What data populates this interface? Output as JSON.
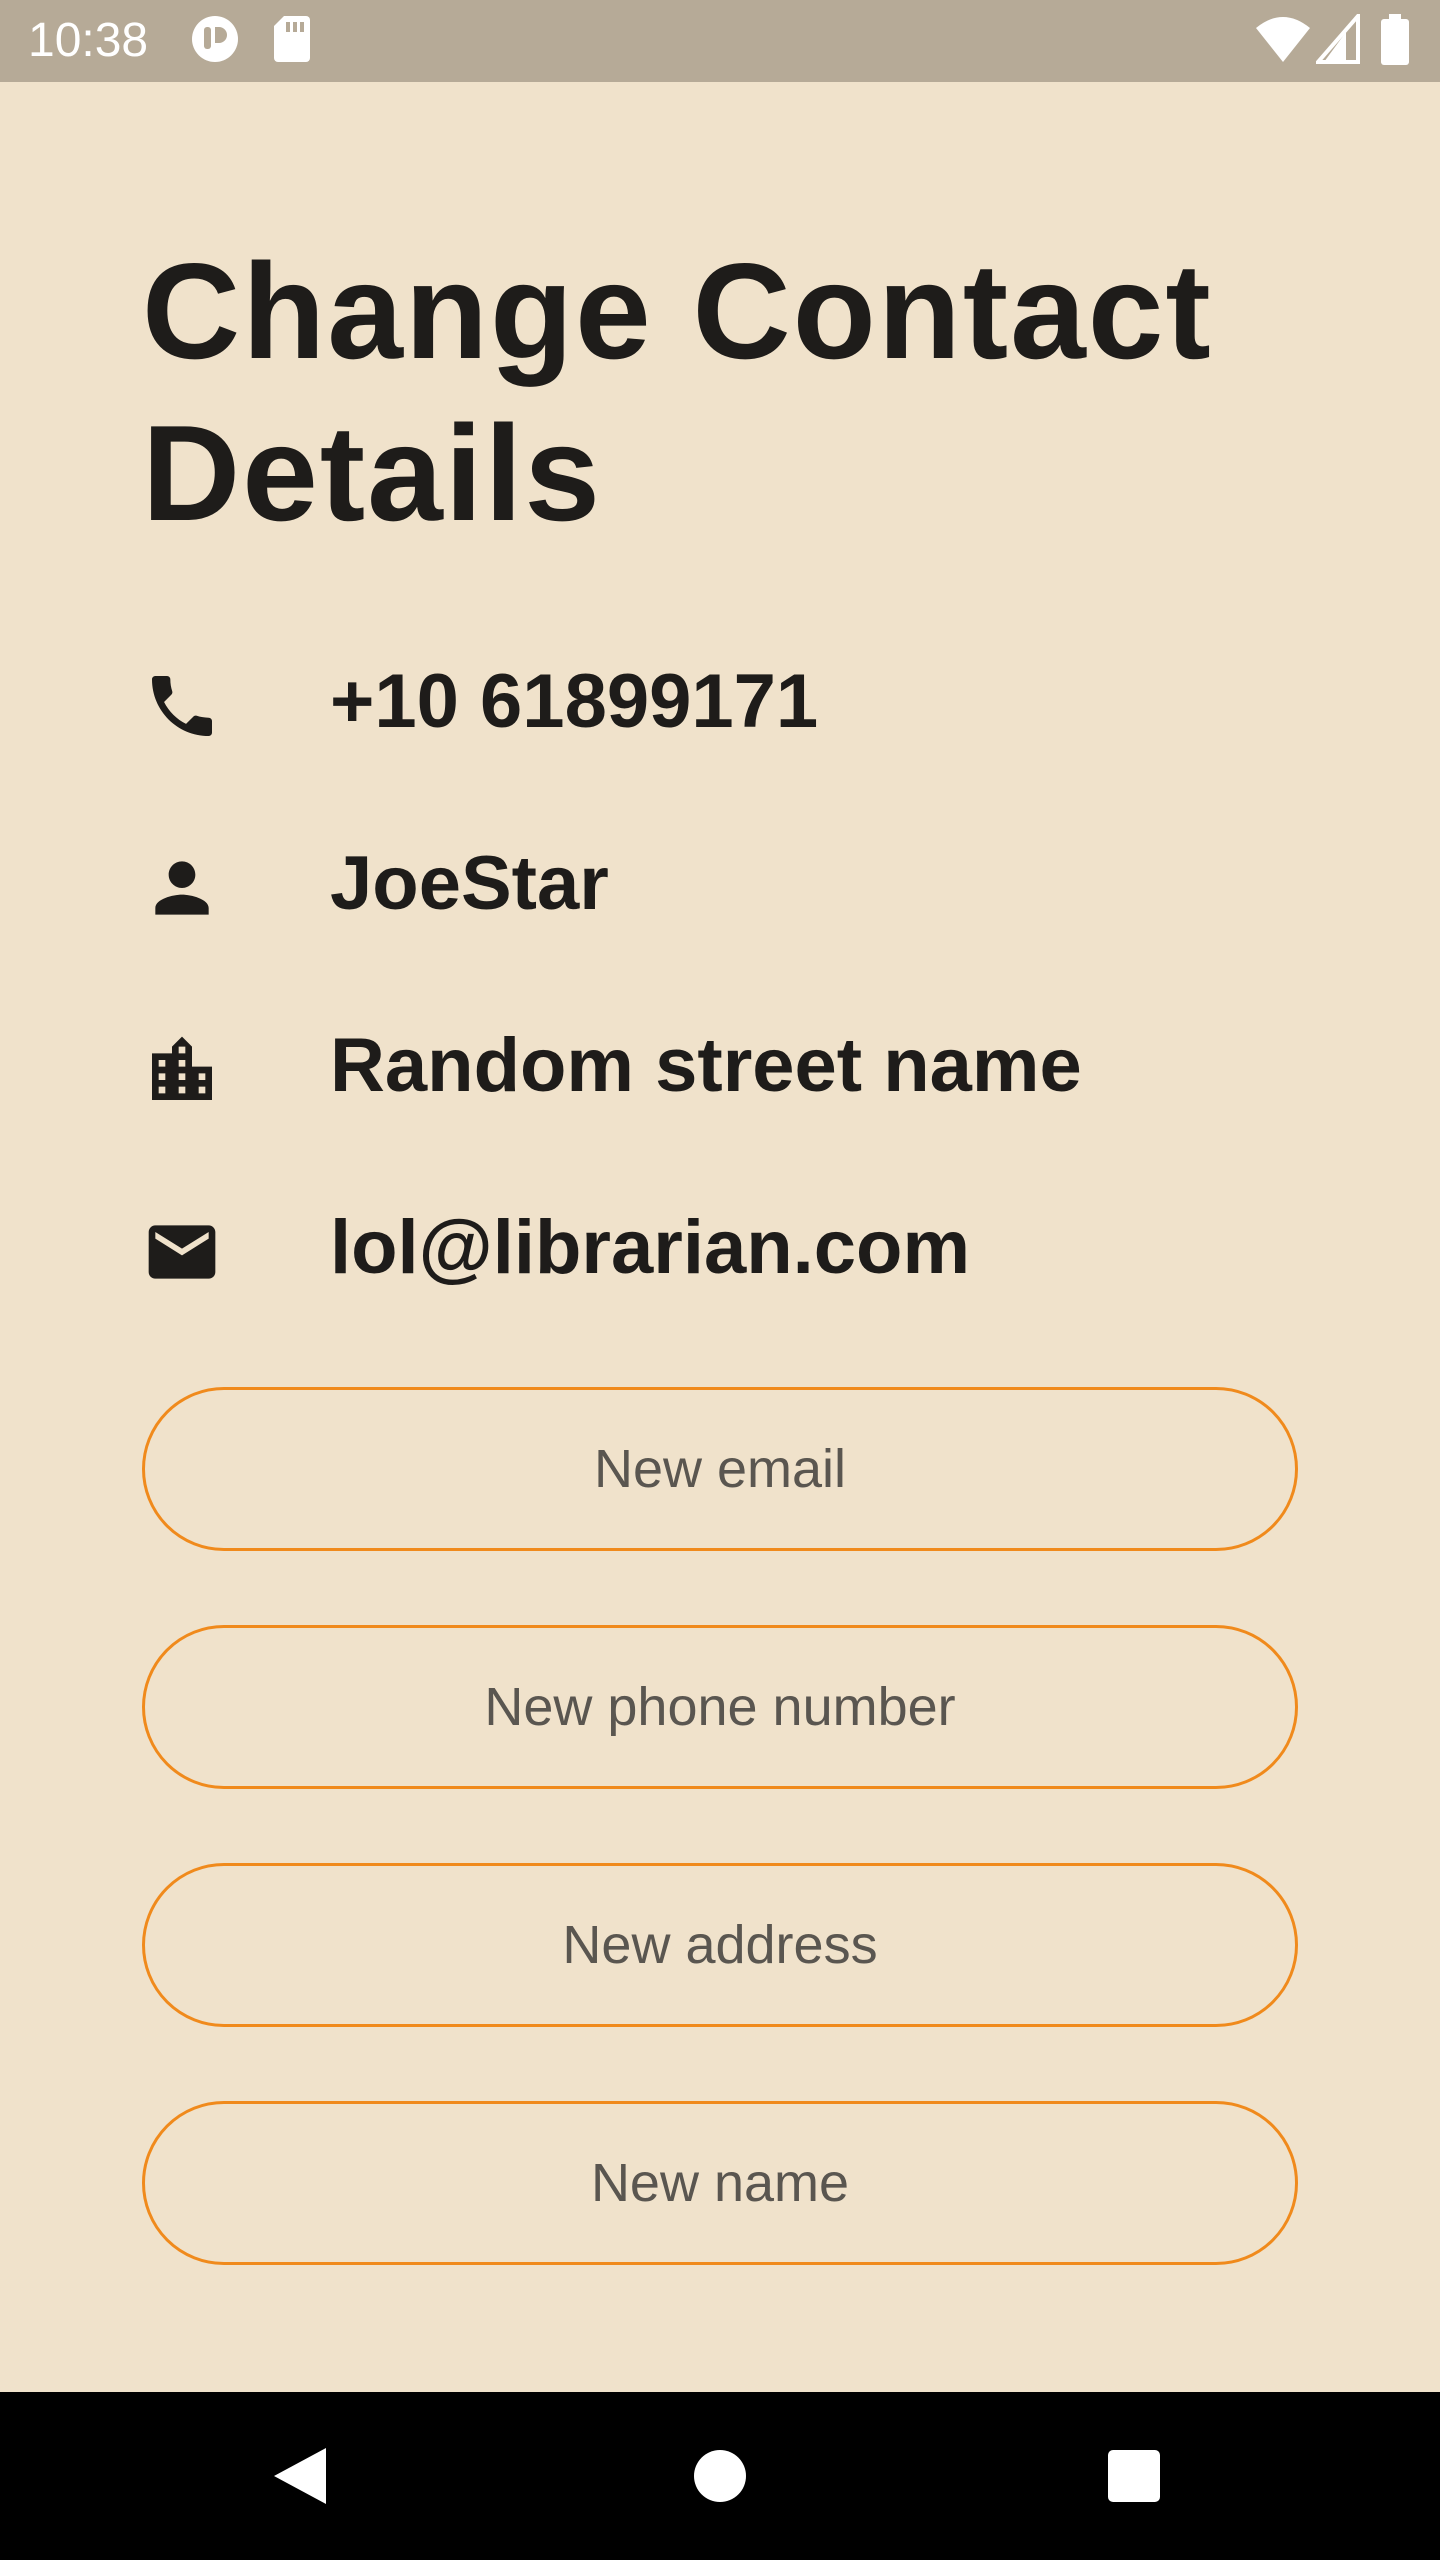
{
  "status_bar": {
    "time": "10:38",
    "icons": [
      "app-notification-icon",
      "sd-card-icon",
      "wifi-icon",
      "signal-icon",
      "battery-icon"
    ]
  },
  "page": {
    "title": "Change Contact Details"
  },
  "contact": {
    "phone": {
      "icon": "phone-icon",
      "value": "+10 61899171"
    },
    "name": {
      "icon": "person-icon",
      "value": "JoeStar"
    },
    "address": {
      "icon": "building-icon",
      "value": "Random street name"
    },
    "email": {
      "icon": "mail-icon",
      "value": "lol@librarian.com"
    }
  },
  "form": {
    "email_placeholder": "New email",
    "phone_placeholder": "New phone number",
    "address_placeholder": "New address",
    "name_placeholder": "New name"
  },
  "colors": {
    "background": "#f0e2cb",
    "status_bar": "#b6aa97",
    "accent": "#f08a1c",
    "text": "#1e1c1a"
  },
  "nav_bar": {
    "icons": [
      "back-icon",
      "home-icon",
      "recents-icon"
    ]
  }
}
